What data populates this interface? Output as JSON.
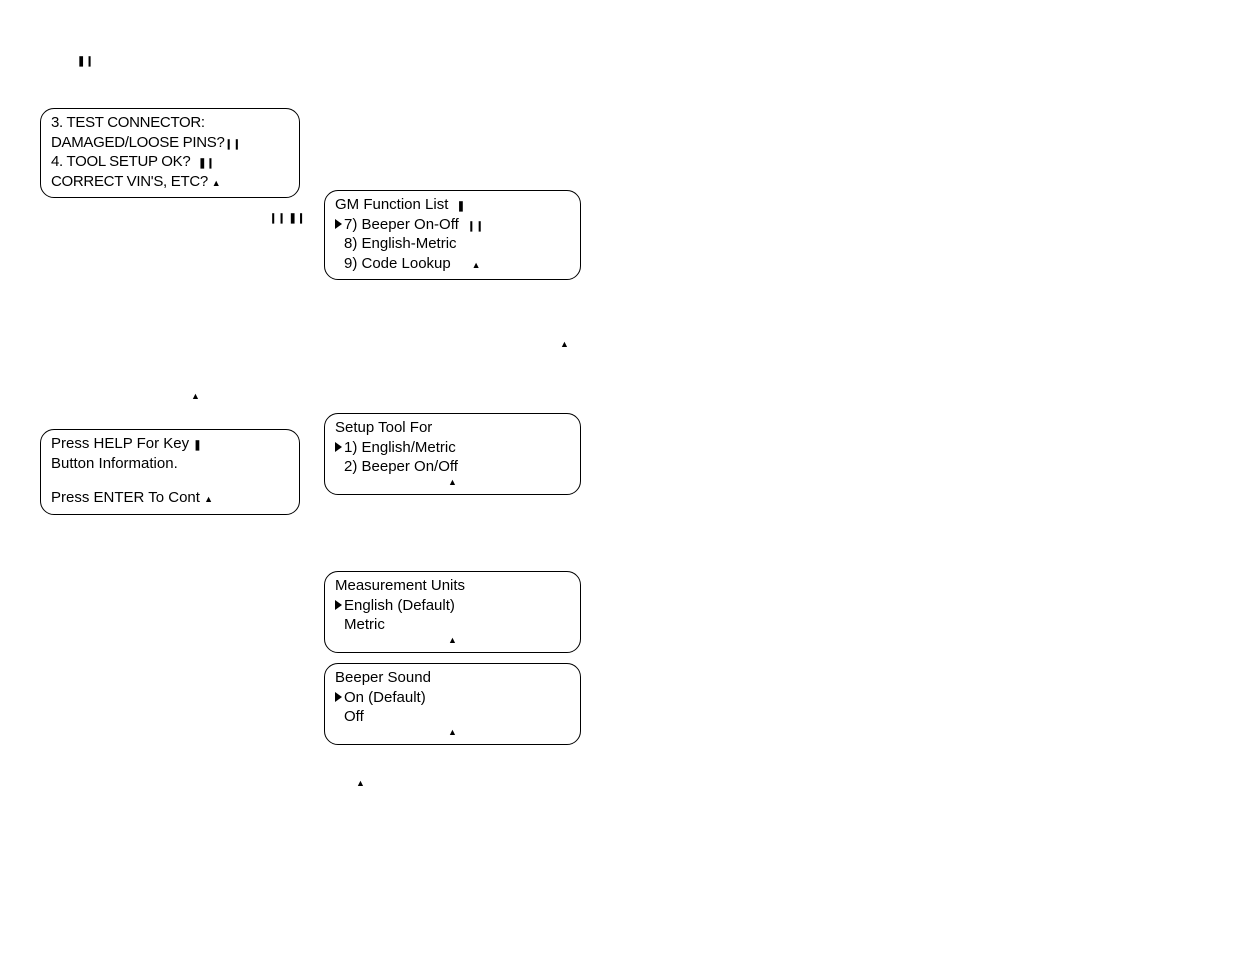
{
  "markers": {
    "top_single": "❚❙",
    "pair": "❙❙ ❚❙"
  },
  "box1": {
    "l1": "3. TEST CONNECTOR:",
    "l2_pre": "DAMAGED/LOOSE PINS?",
    "l2_glyph": "❙❙",
    "l3_pre": "4. TOOL SETUP OK?",
    "l3_glyph": "❚❙",
    "l4_pre": "CORRECT VIN'S, ETC?",
    "l4_glyph": "▲"
  },
  "box2": {
    "l1_pre": "GM Function List",
    "l1_glyph": "❚",
    "l2_pre": "7) Beeper On-Off",
    "l2_glyph": "❙❙",
    "l3": "8) English-Metric",
    "l4_pre": "9) Code Lookup",
    "l4_glyph": "▲"
  },
  "mid_markers": {
    "m1": "▲",
    "m2": "▲"
  },
  "box3": {
    "l1_pre": "Press HELP For Key",
    "l1_glyph": "❚",
    "l2": "Button Information.",
    "l3_pre": "Press ENTER To Cont",
    "l3_glyph": "▲"
  },
  "box4": {
    "l1": "Setup Tool For",
    "l2": "1) English/Metric",
    "l3": "2) Beeper On/Off",
    "glyph": "▲"
  },
  "box5": {
    "l1": "Measurement Units",
    "l2": "English (Default)",
    "l3": "Metric",
    "glyph": "▲"
  },
  "box6": {
    "l1": "Beeper Sound",
    "l2": "On (Default)",
    "l3": "Off",
    "glyph": "▲"
  },
  "bottom_marker": "▲"
}
